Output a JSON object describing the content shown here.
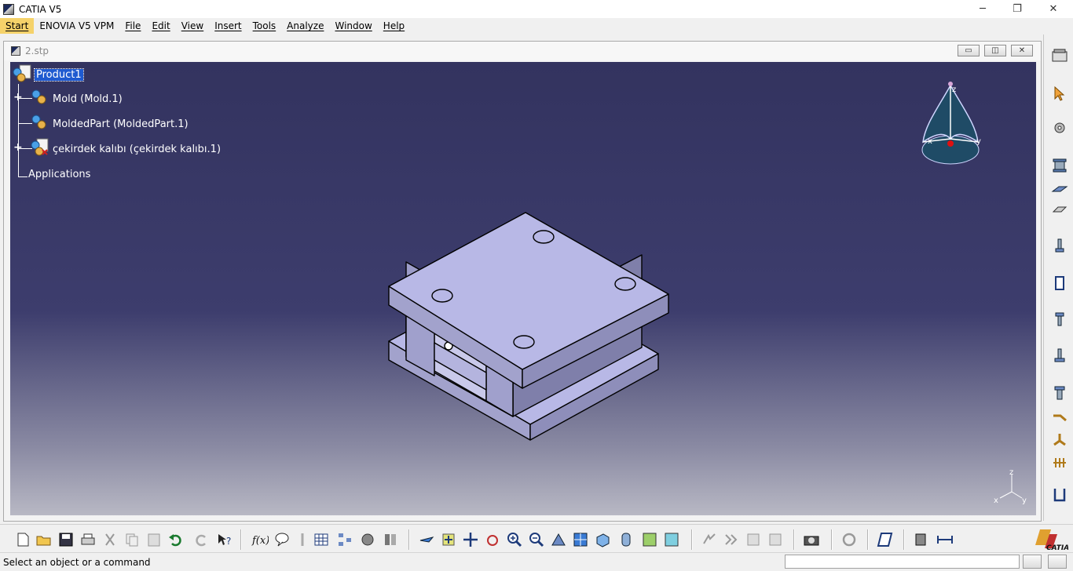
{
  "app": {
    "title": "CATIA V5"
  },
  "window_controls": {
    "minimize": "─",
    "restore": "❐",
    "close": "✕"
  },
  "menu": {
    "items": [
      {
        "label": "Start"
      },
      {
        "label": "ENOVIA V5 VPM"
      },
      {
        "label": "File"
      },
      {
        "label": "Edit"
      },
      {
        "label": "View"
      },
      {
        "label": "Insert"
      },
      {
        "label": "Tools"
      },
      {
        "label": "Analyze"
      },
      {
        "label": "Window"
      },
      {
        "label": "Help"
      }
    ]
  },
  "document": {
    "title": "2.stp",
    "controls": {
      "minimize": "▭",
      "restore": "◫",
      "close": "✕"
    }
  },
  "tree": {
    "root": "Product1",
    "children": [
      {
        "label": "Mold (Mold.1)",
        "expandable": true
      },
      {
        "label": "MoldedPart (MoldedPart.1)",
        "expandable": false
      },
      {
        "label": "çekirdek kalıbı (çekirdek kalıbı.1)",
        "expandable": true
      }
    ],
    "applications": "Applications"
  },
  "compass": {
    "axis_labels": [
      "z",
      "x",
      "y"
    ]
  },
  "axis_triad": {
    "labels": [
      "z",
      "x",
      "y"
    ]
  },
  "status": {
    "message": "Select an object or a command",
    "command_value": ""
  },
  "colors": {
    "viewport_top": "#33335f",
    "viewport_bottom": "#b8b8c4",
    "mold_face": "#b8b8e6",
    "selection": "#1f5bd0",
    "active_menu": "#f5d26a"
  }
}
